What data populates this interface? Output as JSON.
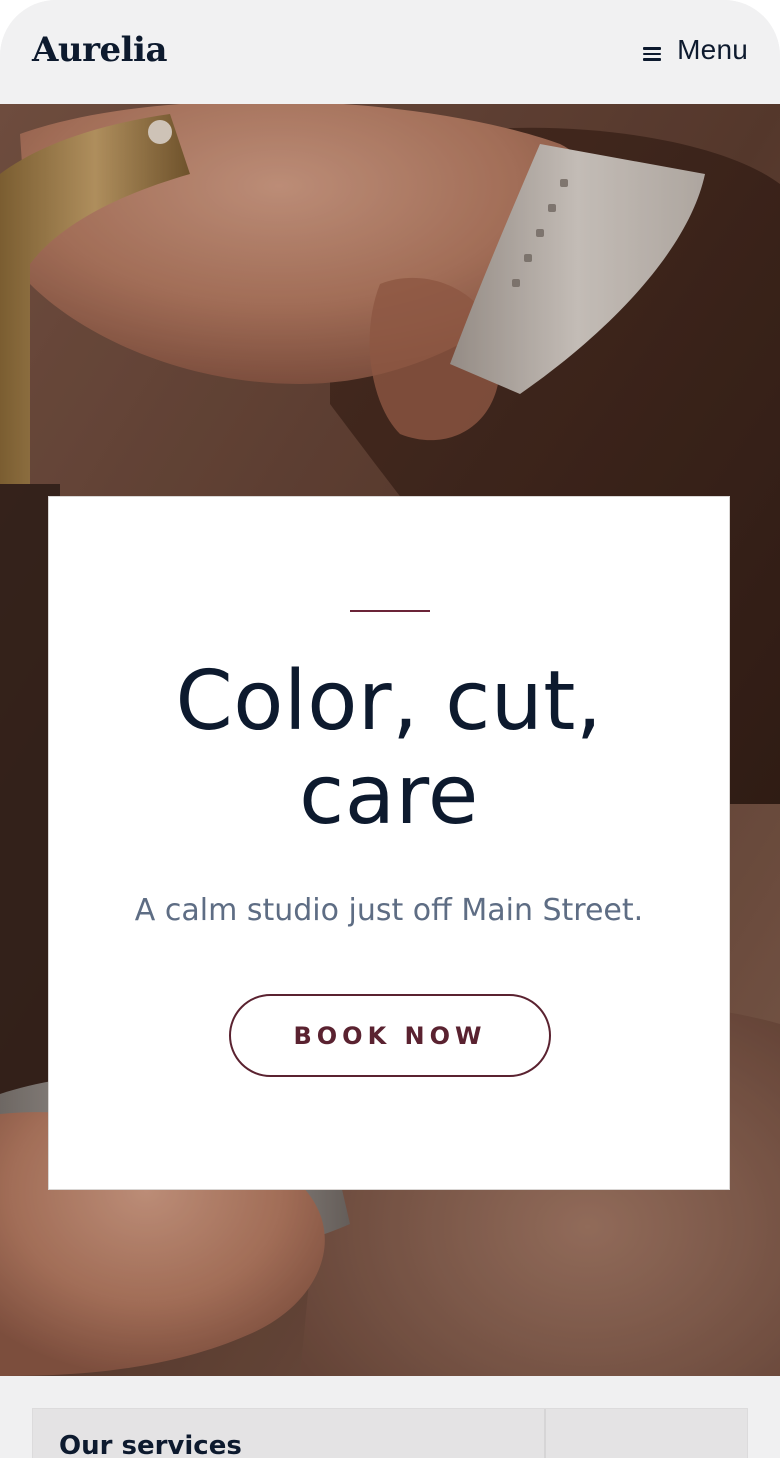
{
  "header": {
    "brand": "Aurelia",
    "menu_label": "Menu"
  },
  "hero": {
    "image": "barber-trimming-hair-photo",
    "title": "Color, cut, care",
    "subtitle": "A calm studio just off Main Street.",
    "cta_label": "BOOK NOW"
  },
  "services": {
    "title": "Our services"
  },
  "colors": {
    "ink": "#0d1a2e",
    "accent": "#5a2230",
    "muted": "#5e6d84",
    "surface": "#f0f0f1"
  },
  "icons": {
    "menu": "hamburger-menu-icon"
  }
}
